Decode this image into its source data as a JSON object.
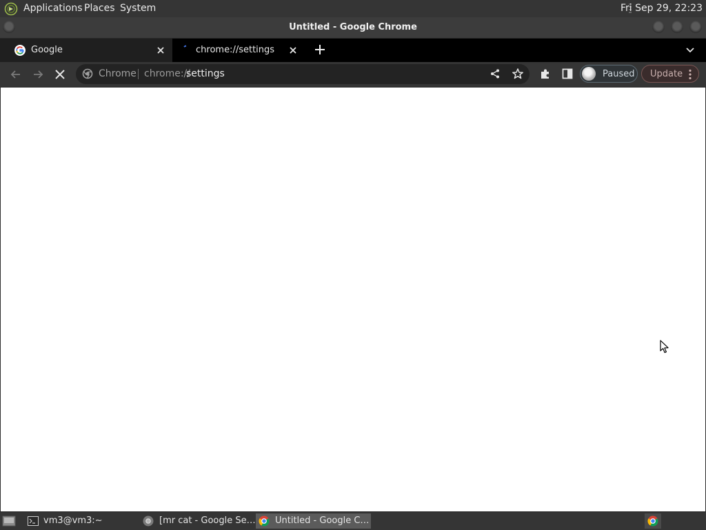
{
  "top_panel": {
    "menus": [
      "Applications",
      "Places",
      "System"
    ],
    "clock": "Fri Sep 29, 22:23"
  },
  "window": {
    "title": "Untitled - Google Chrome"
  },
  "tabs": [
    {
      "title": "Google",
      "icon": "google-g-icon",
      "active": false
    },
    {
      "title": "chrome://settings",
      "icon": "loading-spinner-icon",
      "active": true
    }
  ],
  "toolbar": {
    "omnibox_chip": "Chrome",
    "url_scheme": "chrome://",
    "url_path": "settings",
    "profile_status": "Paused",
    "update_label": "Update"
  },
  "taskbar": {
    "items": [
      {
        "label": "vm3@vm3:~",
        "icon": "terminal-icon"
      },
      {
        "label": "[mr cat - Google Se…",
        "icon": "chrome-icon"
      },
      {
        "label": "Untitled - Google C…",
        "icon": "chrome-icon",
        "active": true
      }
    ]
  },
  "colors": {
    "page_background": "#ffffff",
    "toolbar": "#353535",
    "tabstrip": "#000000",
    "paused_border": "#5c6a73",
    "update_border": "#7a5654"
  }
}
